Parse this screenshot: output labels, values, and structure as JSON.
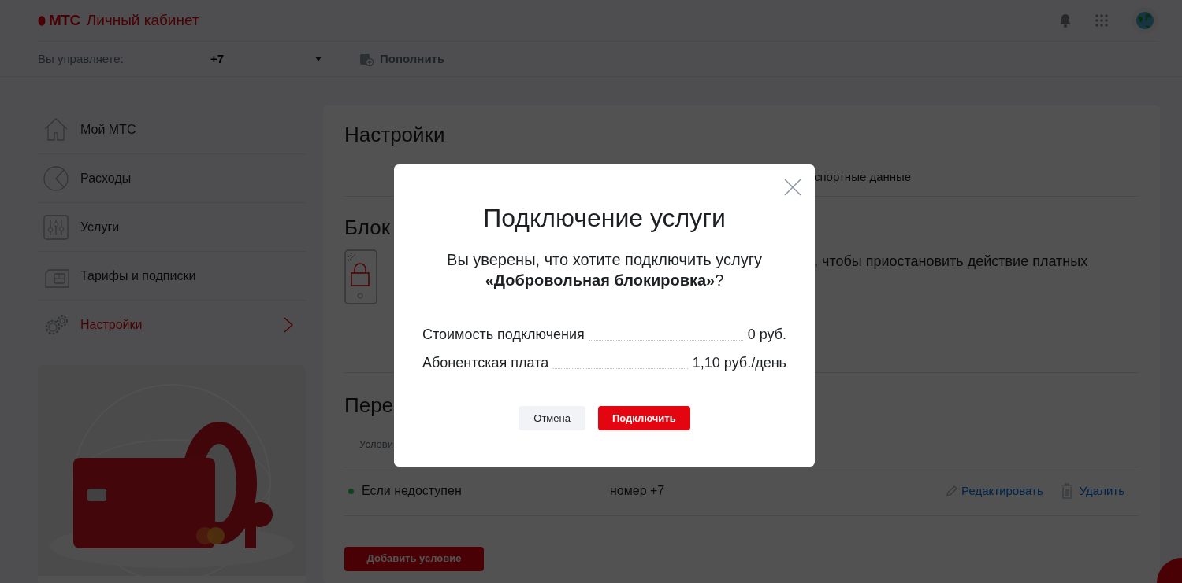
{
  "header": {
    "logo": "МТС",
    "title": "Личный кабинет"
  },
  "account_bar": {
    "label": "Вы управляете:",
    "number": "+7",
    "action": "Пополнить"
  },
  "sidebar": {
    "items": [
      {
        "label": "Мой МТС",
        "kind": "home",
        "selected": false
      },
      {
        "label": "Расходы",
        "kind": "expenses",
        "selected": false
      },
      {
        "label": "Услуги",
        "kind": "services",
        "selected": false
      },
      {
        "label": "Тарифы и подписки",
        "kind": "tariffs",
        "selected": false
      },
      {
        "label": "Настройки",
        "kind": "settings",
        "selected": true
      }
    ]
  },
  "main": {
    "title": "Настройки",
    "tab_fragment": "спортные данные",
    "section_1_title": "Блок",
    "section_1_text": ", чтобы приостановить действие платных",
    "section_2_title": "Пере",
    "section_2_subtitle": "Услови",
    "conditions": [
      {
        "condition": "Если недоступен",
        "target": "номер +7",
        "edit": "Редактировать",
        "delete": "Удалить"
      }
    ],
    "add_button": "Добавить условие"
  },
  "modal": {
    "title": "Подключение услуги",
    "question": "Вы уверены, что хотите подключить услугу\n**«Добровольная блокировка»**?",
    "fees": [
      {
        "label": "Стоимость подключения",
        "value": "0 руб."
      },
      {
        "label": "Абонентская плата",
        "value": "1,10 руб./день"
      }
    ],
    "buttons": [
      {
        "label": "Отмена",
        "kind": "secondary"
      },
      {
        "label": "Подключить",
        "kind": "primary"
      }
    ]
  }
}
